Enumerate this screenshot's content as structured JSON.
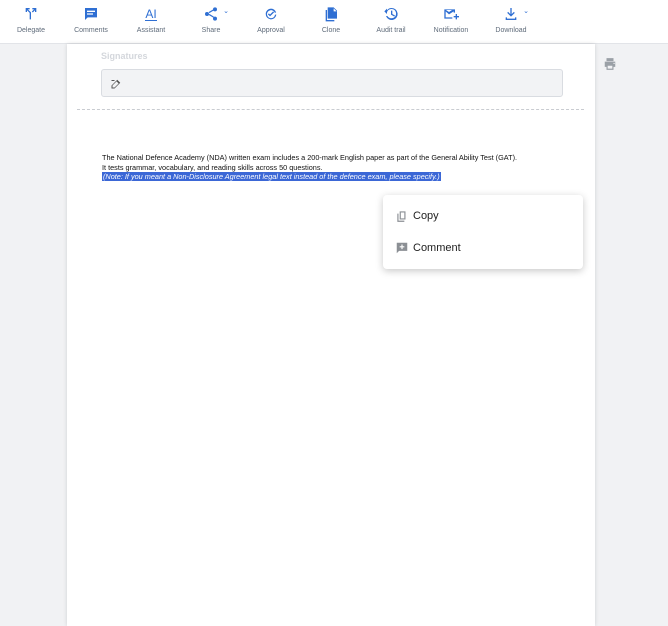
{
  "toolbar": {
    "items": [
      {
        "label": "Delegate",
        "icon": "delegate-icon"
      },
      {
        "label": "Comments",
        "icon": "comments-icon"
      },
      {
        "label": "Assistant",
        "icon": "assistant-ai-icon"
      },
      {
        "label": "Share",
        "icon": "share-icon"
      },
      {
        "label": "Approval",
        "icon": "approval-icon"
      },
      {
        "label": "Clone",
        "icon": "clone-icon"
      },
      {
        "label": "Audit trail",
        "icon": "audit-trail-icon"
      },
      {
        "label": "Notification",
        "icon": "notification-icon"
      },
      {
        "label": "Download",
        "icon": "download-icon"
      }
    ],
    "assistant_glyph": "AI",
    "accent_color": "#2f6fd3"
  },
  "document": {
    "signatures_label": "Signatures",
    "lines": [
      "The National Defence Academy (NDA) written exam includes a 200-mark English paper as part of the General Ability Test (GAT).",
      "It tests grammar, vocabulary, and reading skills across 50 questions."
    ],
    "highlighted_note": "(Note: If you meant a Non-Disclosure Agreement legal text instead of the defence exam, please specify.)",
    "highlight_color": "#3b67d6"
  },
  "context_menu": {
    "items": [
      {
        "label": "Copy",
        "icon": "copy-icon"
      },
      {
        "label": "Comment",
        "icon": "add-comment-icon"
      }
    ]
  }
}
